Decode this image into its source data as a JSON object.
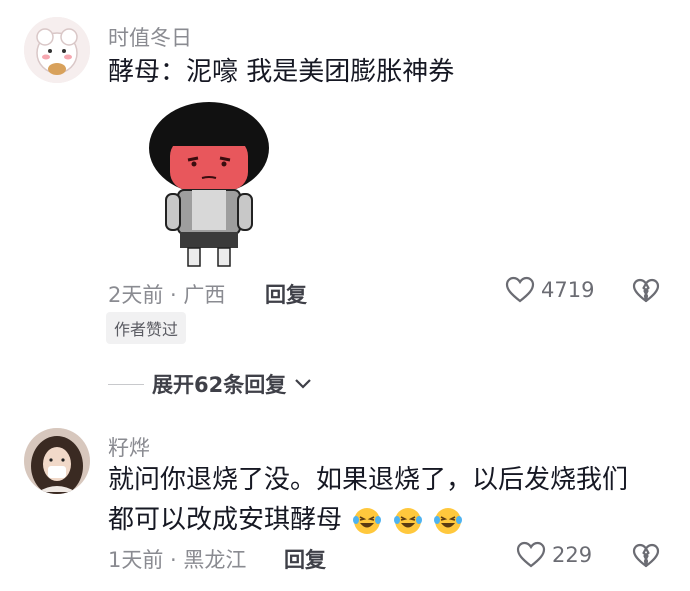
{
  "comments": [
    {
      "username": "时值冬日",
      "text": "酵母：泥嚎 我是美团膨胀神券",
      "time_location": "2天前 · 广西",
      "reply_label": "回复",
      "likes": "4719",
      "badge": "作者赞过",
      "sticker_icon": "cartoon-red-face-kid-sticker"
    },
    {
      "username": "籽烨",
      "text_line1": "就问你退烧了没。如果退烧了，以后发烧我们",
      "text_line2": "都可以改成安琪酵母",
      "time_location": "1天前 · 黑龙江",
      "reply_label": "回复",
      "likes": "229",
      "emoji_icon": "laughing-tears-emoji"
    }
  ],
  "expand_replies": {
    "label": "展开62条回复"
  },
  "colors": {
    "meta_gray": "#8a8b91",
    "text_dark": "#161823",
    "emoji_yellow": "#ffc83d"
  }
}
